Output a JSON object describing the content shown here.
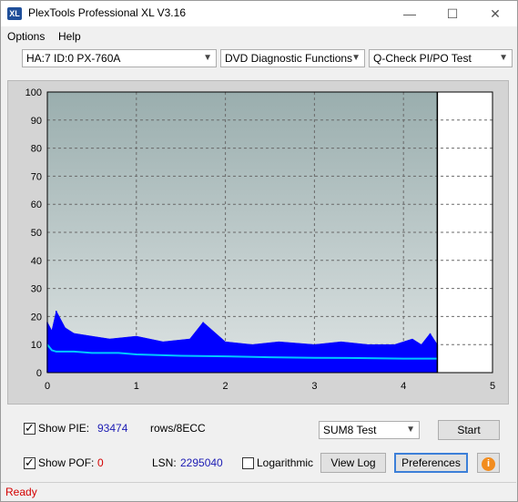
{
  "window": {
    "title": "PlexTools Professional XL V3.16",
    "icon_text": "XL"
  },
  "window_controls": {
    "minimize": "—",
    "maximize": "☐",
    "close": "✕"
  },
  "menu": {
    "options": "Options",
    "help": "Help"
  },
  "toolbar": {
    "drive": "HA:7 ID:0  PX-760A",
    "function": "DVD Diagnostic Functions",
    "test": "Q-Check PI/PO Test"
  },
  "chart_data": {
    "type": "area",
    "x_ticks": [
      "0",
      "1",
      "2",
      "3",
      "4",
      "5"
    ],
    "y_ticks": [
      "0",
      "10",
      "20",
      "30",
      "40",
      "50",
      "60",
      "70",
      "80",
      "90",
      "100"
    ],
    "xlim": [
      0,
      5
    ],
    "ylim": [
      0,
      100
    ],
    "grid": true,
    "end_marker_x": 4.38,
    "series": [
      {
        "color": "#0000ff",
        "style": "bars",
        "x": [
          0.0,
          0.05,
          0.1,
          0.2,
          0.3,
          0.5,
          0.7,
          1.0,
          1.3,
          1.6,
          1.75,
          2.0,
          2.3,
          2.6,
          3.0,
          3.3,
          3.6,
          3.9,
          4.1,
          4.2,
          4.3,
          4.38
        ],
        "values": [
          18,
          15,
          22,
          16,
          14,
          13,
          12,
          13,
          11,
          12,
          18,
          11,
          10,
          11,
          10,
          11,
          10,
          10,
          12,
          10,
          14,
          10
        ]
      },
      {
        "color": "#00c8ff",
        "style": "line",
        "x": [
          0.0,
          0.05,
          0.1,
          0.3,
          0.5,
          0.8,
          1.0,
          1.5,
          2.0,
          2.5,
          3.0,
          3.5,
          4.0,
          4.38
        ],
        "values": [
          10,
          8,
          7.5,
          7.5,
          7,
          7,
          6.5,
          6,
          5.8,
          5.5,
          5.3,
          5.2,
          5,
          5
        ]
      }
    ],
    "colors": {
      "plot_top": "#9aaeae",
      "plot_bottom": "#dde3e3",
      "after_end": "#ffffff",
      "frame_bg": "#d4d4d4"
    }
  },
  "controls": {
    "show_pie_label": "Show PIE:",
    "pie_value": "93474",
    "rows_label": "rows/8ECC",
    "show_pof_label": "Show POF:",
    "pof_value": "0",
    "lsn_label": "LSN:",
    "lsn_value": "2295040",
    "logarithmic_label": "Logarithmic",
    "sum8_value": "SUM8 Test",
    "start_button": "Start",
    "viewlog_button": "View Log",
    "preferences_button": "Preferences",
    "info_icon": "i",
    "show_pie_checked": true,
    "show_pof_checked": true,
    "log_checked": false
  },
  "status": {
    "text": "Ready"
  }
}
